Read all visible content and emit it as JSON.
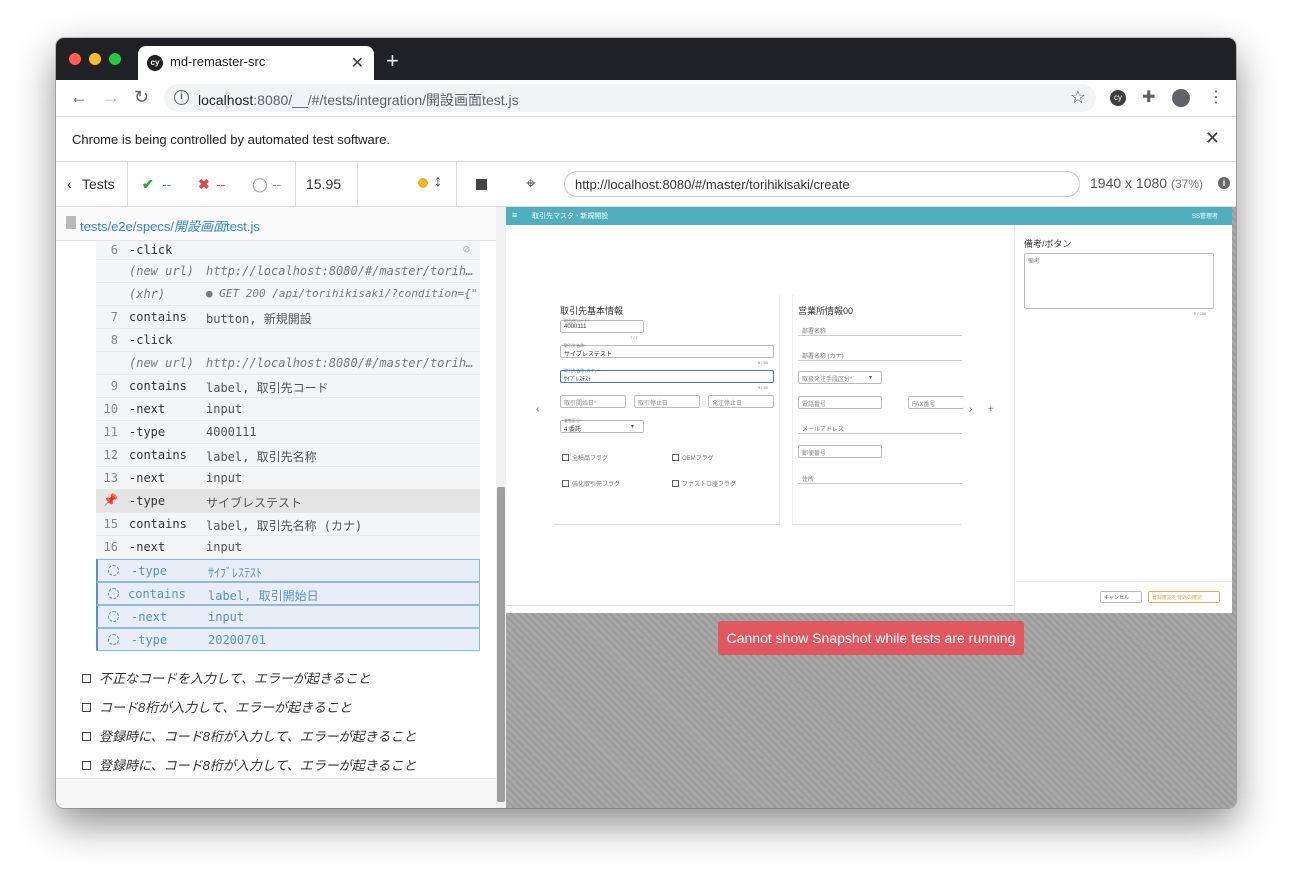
{
  "browser": {
    "tab_title": "md-remaster-src",
    "favicon_text": "cy",
    "url_host": "localhost",
    "url_rest": ":8080/__/#/tests/integration/開設画面test.js",
    "infobar_message": "Chrome is being controlled by automated test software."
  },
  "runner": {
    "tests_label": "Tests",
    "passed": "--",
    "failed": "--",
    "pending": "--",
    "duration": "15.95",
    "spec_path_prefix": "tests/e2e/specs/",
    "spec_path_file": "開設画面",
    "spec_path_suffix": "test.js",
    "aut_url": "http://localhost:8080/#/master/torihikisaki/create",
    "viewport": "1940 x 1080",
    "scale": "(37%)",
    "snapshot_message": "Cannot show Snapshot while tests are running"
  },
  "commands": [
    {
      "num": "6",
      "name": "-click",
      "msg": ""
    },
    {
      "num": "",
      "name": "(new url)",
      "msg": "http://localhost:8080/#/master/torih…"
    },
    {
      "num": "",
      "name": "(xhr)",
      "msg": "● GET 200 /api/torihikisaki/?condition={\"c…"
    },
    {
      "num": "7",
      "name": "contains",
      "msg": "button, 新規開設"
    },
    {
      "num": "8",
      "name": "-click",
      "msg": ""
    },
    {
      "num": "",
      "name": "(new url)",
      "msg": "http://localhost:8080/#/master/torih…"
    },
    {
      "num": "9",
      "name": "contains",
      "msg": "label, 取引先コード"
    },
    {
      "num": "10",
      "name": "-next",
      "msg": "input"
    },
    {
      "num": "11",
      "name": "-type",
      "msg": "4000111"
    },
    {
      "num": "12",
      "name": "contains",
      "msg": "label, 取引先名称"
    },
    {
      "num": "13",
      "name": "-next",
      "msg": "input"
    },
    {
      "num": "",
      "name": "-type",
      "msg": "サイブレステスト"
    },
    {
      "num": "15",
      "name": "contains",
      "msg": "label, 取引先名称 (カナ)"
    },
    {
      "num": "16",
      "name": "-next",
      "msg": "input"
    },
    {
      "num": "",
      "name": "-type",
      "msg": "ｻｲﾌﾞﾚｽﾃｽﾄ"
    },
    {
      "num": "",
      "name": "contains",
      "msg": "label, 取引開始日"
    },
    {
      "num": "",
      "name": "-next",
      "msg": "input"
    },
    {
      "num": "",
      "name": "-type",
      "msg": "20200701"
    }
  ],
  "todo_tests": [
    "不正なコードを入力して、エラーが起きること",
    "コード8桁が入力して、エラーが起きること",
    "登録時に、コード8桁が入力して、エラーが起きること",
    "登録時に、コード8桁が入力して、エラーが起きること"
  ],
  "app": {
    "header_title": "取引先マスタ - 新規開設",
    "user": "SS管理者",
    "section_basic": "取引先基本情報",
    "section_office": "営業所情報00",
    "section_notes": "備考/ボタン",
    "code_label": "取引先コード*",
    "code_value": "4000111",
    "code_counter": "7 / 7",
    "name_label": "取引先名称*",
    "name_value": "サイブレステスト",
    "name_counter": "8 / 50",
    "kana_label": "取引先名称 (カナ) *",
    "kana_value": "ｻｲﾌﾞﾚｽﾃｽﾄ",
    "kana_counter": "9 / 50",
    "start_date": "取引開始日*",
    "stop_date": "取引停止日",
    "order_stop_date": "発注停止日",
    "category_label": "業態区分*",
    "category_value": "4:委託",
    "flag_all": "全積品フラグ",
    "flag_oem": "OEMフラグ",
    "flag_strong": "強化取引先フラグ",
    "flag_fast": "ファストロ座フラグ",
    "dept_name": "部署名称",
    "dept_kana": "部署名称 (カナ)",
    "order_method": "取扱発注手段区分*",
    "phone": "電話番号",
    "fax": "FAX番号",
    "email": "メールアドレス",
    "zip": "郵便番号",
    "address": "住所",
    "notes_placeholder": "備考",
    "notes_counter": "0 / 200",
    "cancel": "キャンセル",
    "submit": "登録確認を有効の確認"
  },
  "colors": {
    "pass": "#28a745",
    "fail": "#e04848",
    "accent": "#3386d4",
    "app_header": "#4fafbf",
    "snapshot_error": "#e0575f"
  }
}
